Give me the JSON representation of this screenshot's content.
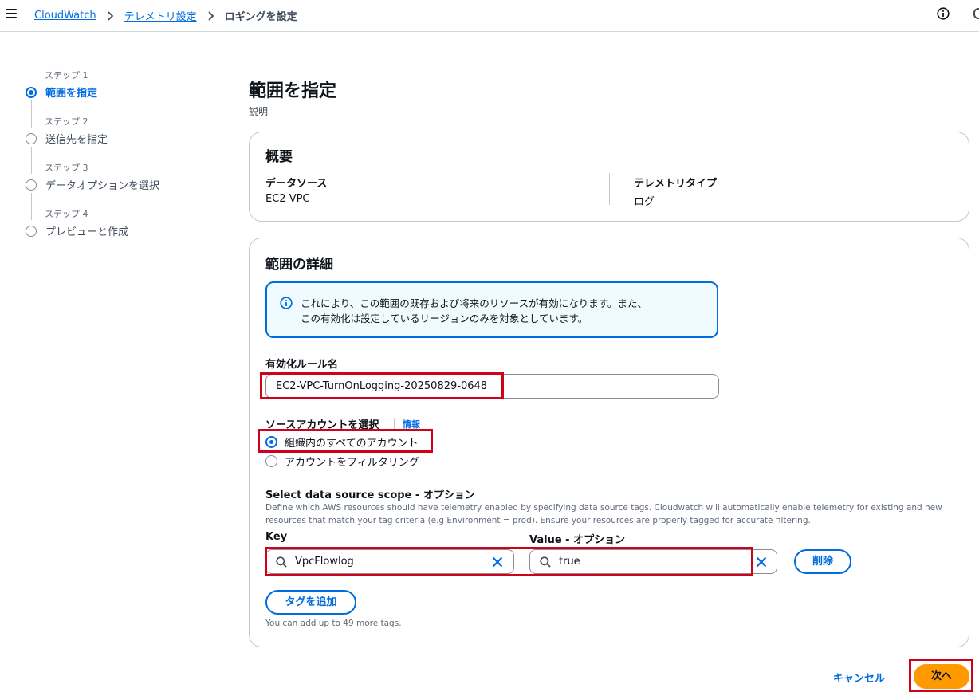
{
  "breadcrumb": {
    "items": [
      "CloudWatch",
      "テレメトリ設定"
    ],
    "current": "ロギングを設定"
  },
  "stepper": {
    "steps": [
      {
        "number": "ステップ 1",
        "label": "範囲を指定"
      },
      {
        "number": "ステップ 2",
        "label": "送信先を指定"
      },
      {
        "number": "ステップ 3",
        "label": "データオプションを選択"
      },
      {
        "number": "ステップ 4",
        "label": "プレビューと作成"
      }
    ],
    "active_index": 0
  },
  "page": {
    "title": "範囲を指定",
    "description": "説明"
  },
  "overview": {
    "title": "概要",
    "data_source_label": "データソース",
    "data_source_value": "EC2 VPC",
    "telemetry_type_label": "テレメトリタイプ",
    "telemetry_type_value": "ログ"
  },
  "details": {
    "title": "範囲の詳細",
    "alert_line1": "これにより、この範囲の既存および将来のリソースが有効になります。また、",
    "alert_line2": "この有効化は設定しているリージョンのみを対象としています。",
    "rule_name_label": "有効化ルール名",
    "rule_name_value": "EC2-VPC-TurnOnLogging-20250829-0648",
    "source_account_label": "ソースアカウントを選択",
    "info_link": "情報",
    "radio_options": [
      "組織内のすべてのアカウント",
      "アカウントをフィルタリング"
    ],
    "radio_selected": 0,
    "scope_title": "Select data source scope - オプション",
    "scope_desc": "Define which AWS resources should have telemetry enabled by specifying data source tags. Cloudwatch will automatically enable telemetry for existing and new resources that match your tag criteria (e.g Environment = prod). Ensure your resources are properly tagged for accurate filtering.",
    "key_label": "Key",
    "key_value": "VpcFlowlog",
    "value_label": "Value - オプション",
    "value_value": "true",
    "remove_button": "削除",
    "add_tag_button": "タグを追加",
    "tags_hint": "You can add up to 49 more tags."
  },
  "footer": {
    "cancel": "キャンセル",
    "next": "次へ"
  },
  "colors": {
    "accent": "#006ce0",
    "primary_button": "#ff9900",
    "highlight": "#d0021b"
  }
}
